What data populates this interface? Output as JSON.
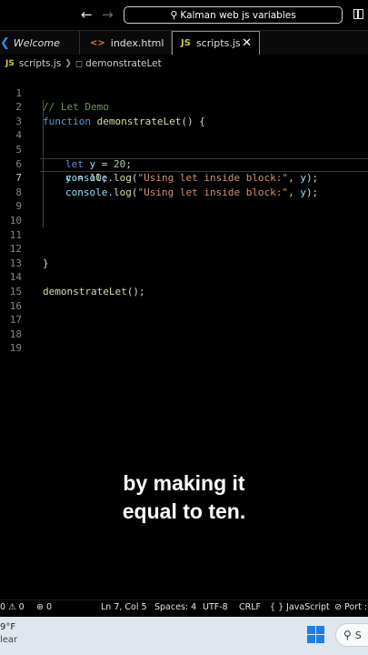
{
  "titlebar": {
    "search_text": "Kalman web js variables",
    "back_icon": "arrow-left-icon",
    "forward_icon": "arrow-right-icon"
  },
  "tabs": [
    {
      "label": "Welcome",
      "icon": "vscode-icon"
    },
    {
      "label": "index.html",
      "icon": "html-icon"
    },
    {
      "label": "scripts.js",
      "icon": "js-icon",
      "active": true
    }
  ],
  "js_badge": "JS",
  "breadcrumb": {
    "file": "scripts.js",
    "symbol": "demonstrateLet"
  },
  "editor": {
    "line_numbers": [
      "1",
      "2",
      "3",
      "4",
      "5",
      "6",
      "7",
      "8",
      "9",
      "10",
      "11",
      "12",
      "13",
      "14",
      "15",
      "16",
      "17",
      "18",
      "19"
    ],
    "active_line": 7,
    "lines": {
      "l1": "// Let Demo",
      "l2_kw": "function",
      "l2_fn": "demonstrateLet",
      "l2_rest": "() {",
      "l5_kw": "let",
      "l5_var": "y",
      "l5_eq": " = ",
      "l5_num": "20",
      "l5_end": ";",
      "log_obj": "console",
      "log_dot": ".",
      "log_fn": "log",
      "log_open": "(",
      "log_str": "\"Using let inside block:\"",
      "log_comma": ", ",
      "log_var": "y",
      "log_close": ");",
      "l7_var": "y",
      "l7_eq": " = ",
      "l7_num": "10",
      "l7_end": ";",
      "l12": "}",
      "l14_fn": "demonstrateLet",
      "l14_rest": "();"
    }
  },
  "caption": {
    "line1": "by making it",
    "line2": "equal to ten."
  },
  "statusbar": {
    "errors": "0",
    "warnings": "0",
    "ports": "0",
    "position": "Ln 7, Col 5",
    "spaces": "Spaces: 4",
    "encoding": "UTF-8",
    "eol": "CRLF",
    "language": "JavaScript",
    "braces": "{ }",
    "port": "Port :"
  },
  "taskbar": {
    "weather_temp": "9°F",
    "weather_desc": "lear",
    "search_text": "S"
  },
  "colors": {
    "keyword": "#569cd6",
    "function": "#dcdcaa",
    "variable": "#9cdcfe",
    "string": "#ce9178",
    "number": "#b5cea8",
    "comment": "#6a9955"
  }
}
